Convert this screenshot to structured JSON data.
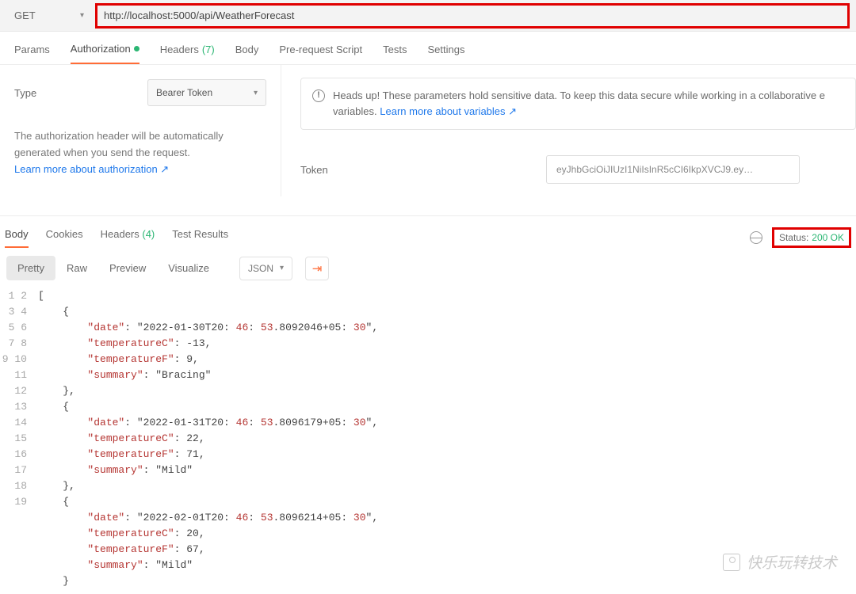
{
  "request": {
    "method": "GET",
    "url": "http://localhost:5000/api/WeatherForecast"
  },
  "reqTabs": {
    "params": "Params",
    "authorization": "Authorization",
    "headers": "Headers",
    "headersCount": "(7)",
    "body": "Body",
    "prerequest": "Pre-request Script",
    "tests": "Tests",
    "settings": "Settings"
  },
  "auth": {
    "typeLabel": "Type",
    "typeValue": "Bearer Token",
    "desc1": "The authorization header will be automatically generated when you send the request.",
    "learn": "Learn more about authorization ↗",
    "banner": "Heads up! These parameters hold sensitive data. To keep this data secure while working in a collaborative e",
    "bannerLine2": "variables.",
    "bannerLink": "Learn more about variables ↗",
    "tokenLabel": "Token",
    "tokenValue": "eyJhbGciOiJIUzI1NiIsInR5cCI6IkpXVCJ9.ey…"
  },
  "respTabs": {
    "body": "Body",
    "cookies": "Cookies",
    "headers": "Headers",
    "headersCount": "(4)",
    "testResults": "Test Results"
  },
  "response": {
    "statusLabel": "Status:",
    "statusValue": "200 OK"
  },
  "fmt": {
    "pretty": "Pretty",
    "raw": "Raw",
    "preview": "Preview",
    "visualize": "Visualize",
    "lang": "JSON"
  },
  "code": {
    "lines": [
      "[",
      "    {",
      "        \"date\": \"2022-01-30T20:46:53.8092046+05:30\",",
      "        \"temperatureC\": -13,",
      "        \"temperatureF\": 9,",
      "        \"summary\": \"Bracing\"",
      "    },",
      "    {",
      "        \"date\": \"2022-01-31T20:46:53.8096179+05:30\",",
      "        \"temperatureC\": 22,",
      "        \"temperatureF\": 71,",
      "        \"summary\": \"Mild\"",
      "    },",
      "    {",
      "        \"date\": \"2022-02-01T20:46:53.8096214+05:30\",",
      "        \"temperatureC\": 20,",
      "        \"temperatureF\": 67,",
      "        \"summary\": \"Mild\"",
      "    }"
    ]
  },
  "watermark": "快乐玩转技术"
}
